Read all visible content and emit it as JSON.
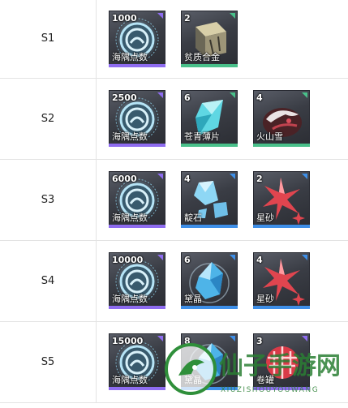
{
  "rarity_colors": {
    "purple": "#8e6cf0",
    "green": "#49c08a",
    "blue": "#3e8fe8"
  },
  "rows": [
    {
      "stage": "S1",
      "items": [
        {
          "qty": "1000",
          "name": "海隅点数",
          "icon": "coin-emblem-icon",
          "rarity": "purple"
        },
        {
          "qty": "2",
          "name": "贫质合金",
          "icon": "alloy-block-icon",
          "rarity": "green"
        }
      ]
    },
    {
      "stage": "S2",
      "items": [
        {
          "qty": "2500",
          "name": "海隅点数",
          "icon": "coin-emblem-icon",
          "rarity": "purple"
        },
        {
          "qty": "6",
          "name": "苍青薄片",
          "icon": "cyan-shard-icon",
          "rarity": "green"
        },
        {
          "qty": "4",
          "name": "火山雪",
          "icon": "volcanic-rock-icon",
          "rarity": "green"
        }
      ]
    },
    {
      "stage": "S3",
      "items": [
        {
          "qty": "6000",
          "name": "海隅点数",
          "icon": "coin-emblem-icon",
          "rarity": "purple"
        },
        {
          "qty": "4",
          "name": "靛石",
          "icon": "blue-crystal-icon",
          "rarity": "blue"
        },
        {
          "qty": "2",
          "name": "星砂",
          "icon": "red-star-icon",
          "rarity": "blue"
        }
      ]
    },
    {
      "stage": "S4",
      "items": [
        {
          "qty": "10000",
          "name": "海隅点数",
          "icon": "coin-emblem-icon",
          "rarity": "purple"
        },
        {
          "qty": "6",
          "name": "黛晶",
          "icon": "blue-gem-icon",
          "rarity": "blue"
        },
        {
          "qty": "4",
          "name": "星砂",
          "icon": "red-star-icon",
          "rarity": "blue"
        }
      ]
    },
    {
      "stage": "S5",
      "items": [
        {
          "qty": "15000",
          "name": "海隅点数",
          "icon": "coin-emblem-icon",
          "rarity": "purple"
        },
        {
          "qty": "8",
          "name": "黛晶",
          "icon": "blue-gem-icon",
          "rarity": "blue"
        },
        {
          "qty": "3",
          "name": "卷罐",
          "icon": "red-sphere-icon",
          "rarity": "purple"
        }
      ]
    }
  ],
  "watermark": {
    "title": "仙子手游网",
    "subtitle": "XIUZISHOUYOUWANG"
  }
}
